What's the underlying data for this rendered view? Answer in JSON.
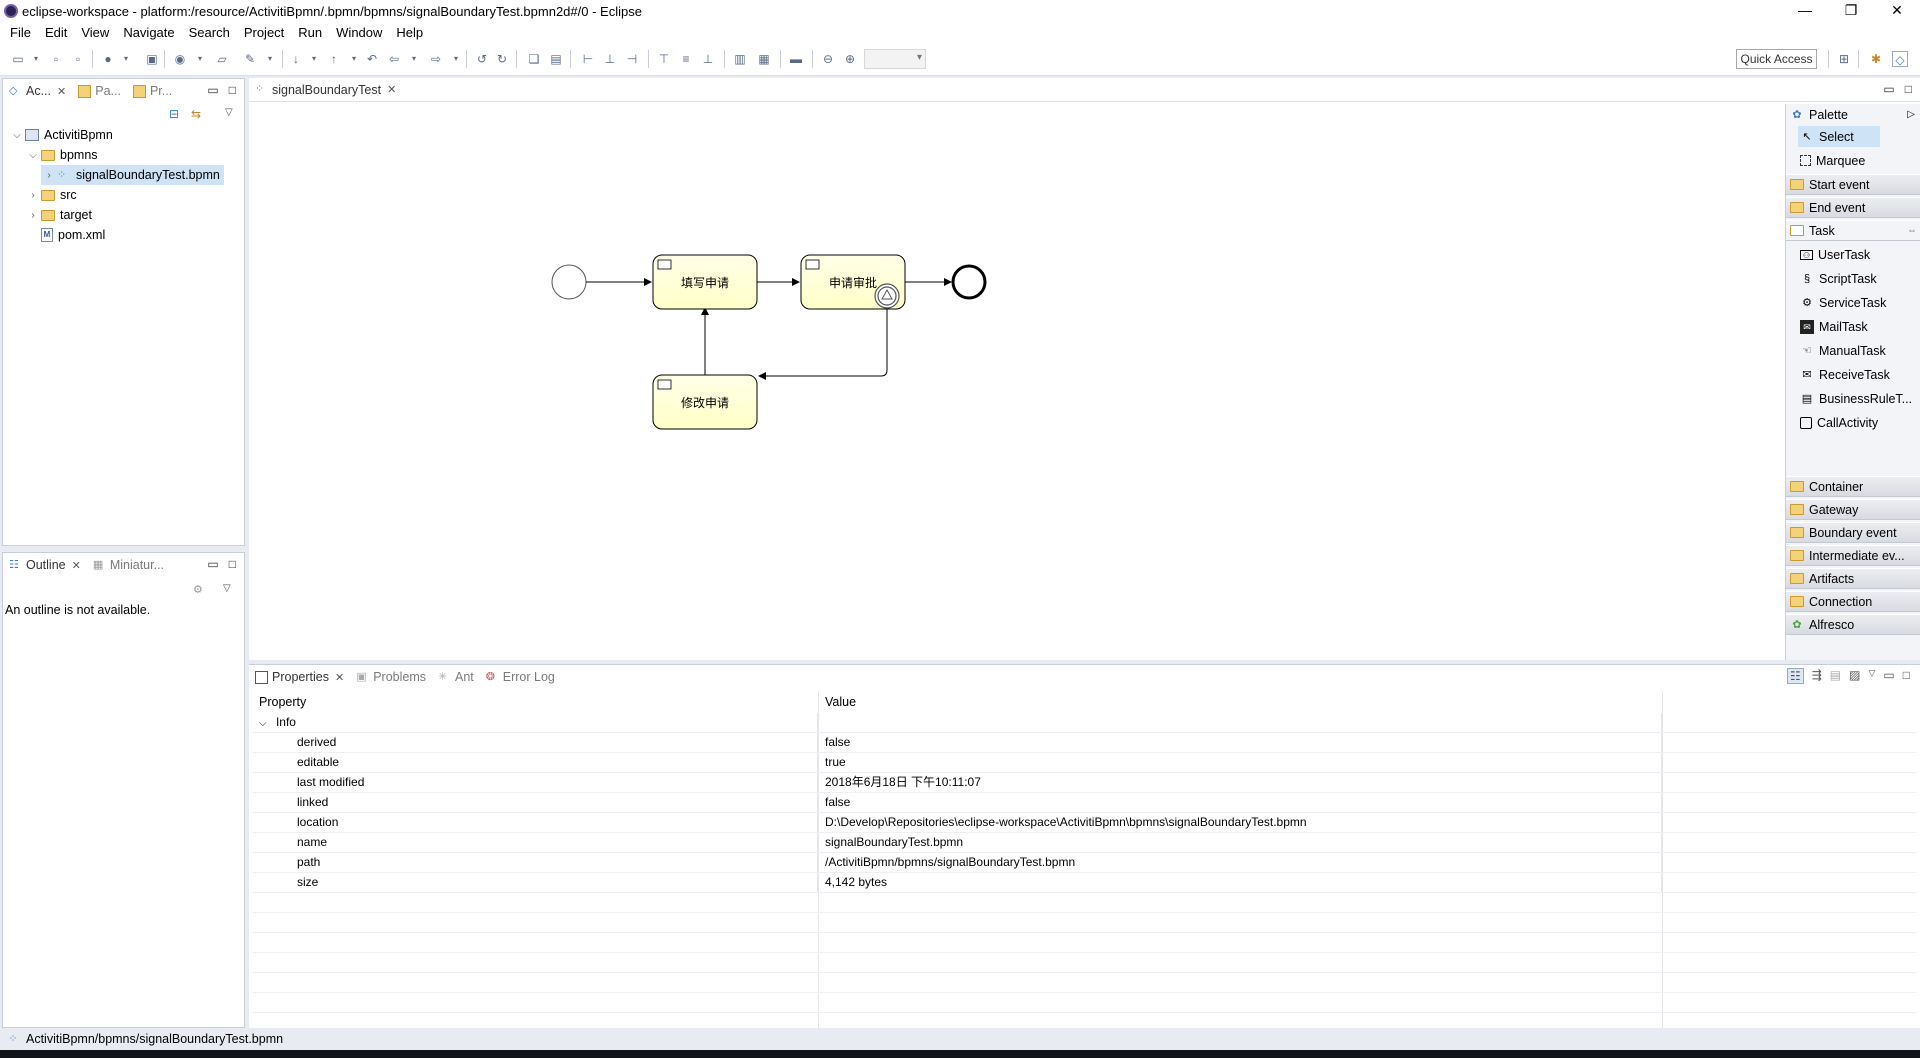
{
  "window": {
    "title": "eclipse-workspace - platform:/resource/ActivitiBpmn/.bpmn/bpmns/signalBoundaryTest.bpmn2d#/0 - Eclipse",
    "minimize": "—",
    "restore": "❐",
    "close": "✕"
  },
  "menu": [
    "File",
    "Edit",
    "View",
    "Navigate",
    "Search",
    "Project",
    "Run",
    "Window",
    "Help"
  ],
  "toolbar": {
    "quick_access": "Quick Access"
  },
  "explorer": {
    "tabs": [
      "Ac...",
      "Pa...",
      "Pr..."
    ],
    "tree": [
      {
        "label": "ActivitiBpmn",
        "type": "project"
      },
      {
        "label": "bpmns",
        "type": "folder"
      },
      {
        "label": "signalBoundaryTest.bpmn",
        "type": "bpmn"
      },
      {
        "label": "src",
        "type": "folder"
      },
      {
        "label": "target",
        "type": "folder"
      },
      {
        "label": "pom.xml",
        "type": "xml"
      }
    ]
  },
  "outline": {
    "tabs": [
      "Outline",
      "Miniatur..."
    ],
    "message": "An outline is not available."
  },
  "editor": {
    "tab": "signalBoundaryTest",
    "diagram": {
      "task_fill": "填写申请",
      "task_approve": "申请审批",
      "task_modify": "修改申请"
    }
  },
  "palette": {
    "title": "Palette",
    "tools": [
      "Select",
      "Marquee"
    ],
    "drawers_top": [
      "Start event",
      "End event",
      "Task"
    ],
    "tasks": [
      "UserTask",
      "ScriptTask",
      "ServiceTask",
      "MailTask",
      "ManualTask",
      "ReceiveTask",
      "BusinessRuleT...",
      "CallActivity"
    ],
    "drawers_bottom": [
      "Container",
      "Gateway",
      "Boundary event",
      "Intermediate ev...",
      "Artifacts",
      "Connection",
      "Alfresco"
    ]
  },
  "properties": {
    "tabs": [
      "Properties",
      "Problems",
      "Ant",
      "Error Log"
    ],
    "col_property": "Property",
    "col_value": "Value",
    "group": "Info",
    "rows": [
      {
        "k": "derived",
        "v": "false"
      },
      {
        "k": "editable",
        "v": "true"
      },
      {
        "k": "last modified",
        "v": "2018年6月18日 下午10:11:07"
      },
      {
        "k": "linked",
        "v": "false"
      },
      {
        "k": "location",
        "v": "D:\\Develop\\Repositories\\eclipse-workspace\\ActivitiBpmn\\bpmns\\signalBoundaryTest.bpmn"
      },
      {
        "k": "name",
        "v": "signalBoundaryTest.bpmn"
      },
      {
        "k": "path",
        "v": "/ActivitiBpmn/bpmns/signalBoundaryTest.bpmn"
      },
      {
        "k": "size",
        "v": "4,142  bytes"
      }
    ]
  },
  "statusbar": {
    "text": "ActivitiBpmn/bpmns/signalBoundaryTest.bpmn"
  },
  "colors": {
    "task_fill": "#ffffcc",
    "selection": "#cfe3f7",
    "accent": "#3a7cc8"
  }
}
